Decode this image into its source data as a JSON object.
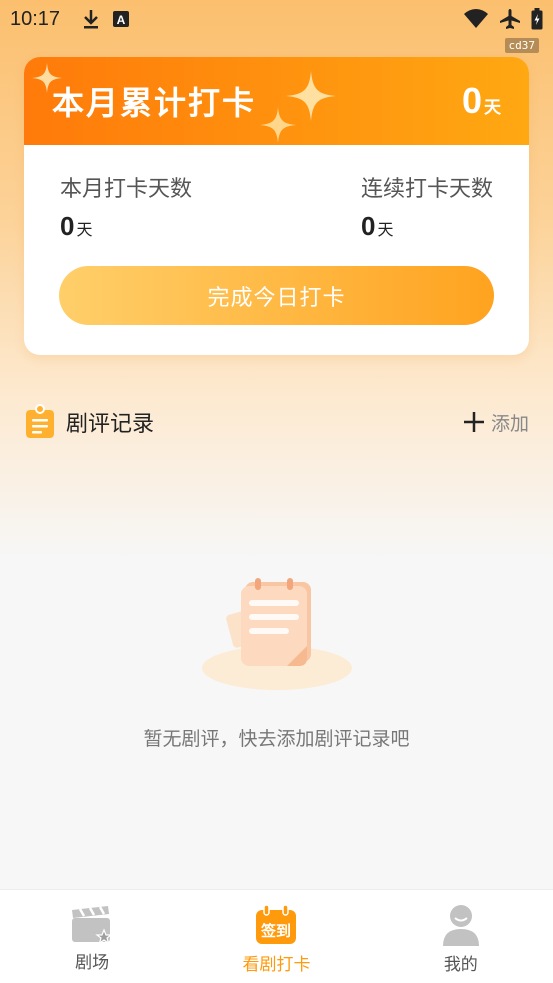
{
  "status_bar": {
    "time": "10:17",
    "debug_tag": "cd37"
  },
  "monthly_card": {
    "title": "本月累计打卡",
    "total_value": "0",
    "total_unit": "天",
    "stats": [
      {
        "label": "本月打卡天数",
        "value": "0",
        "unit": "天"
      },
      {
        "label": "连续打卡天数",
        "value": "0",
        "unit": "天"
      }
    ],
    "checkin_button": "完成今日打卡"
  },
  "review_section": {
    "title": "剧评记录",
    "add_label": "添加",
    "empty_text": "暂无剧评，快去添加剧评记录吧"
  },
  "tabbar": {
    "items": [
      {
        "label": "剧场",
        "icon": "clapperboard-icon"
      },
      {
        "label": "看剧打卡",
        "icon": "checkin-calendar-icon",
        "badge": "签到"
      },
      {
        "label": "我的",
        "icon": "user-icon"
      }
    ],
    "active_index": 1
  },
  "colors": {
    "accent": "#ff9a0c",
    "header_start": "#ff7a0a",
    "header_end": "#ffa812"
  }
}
